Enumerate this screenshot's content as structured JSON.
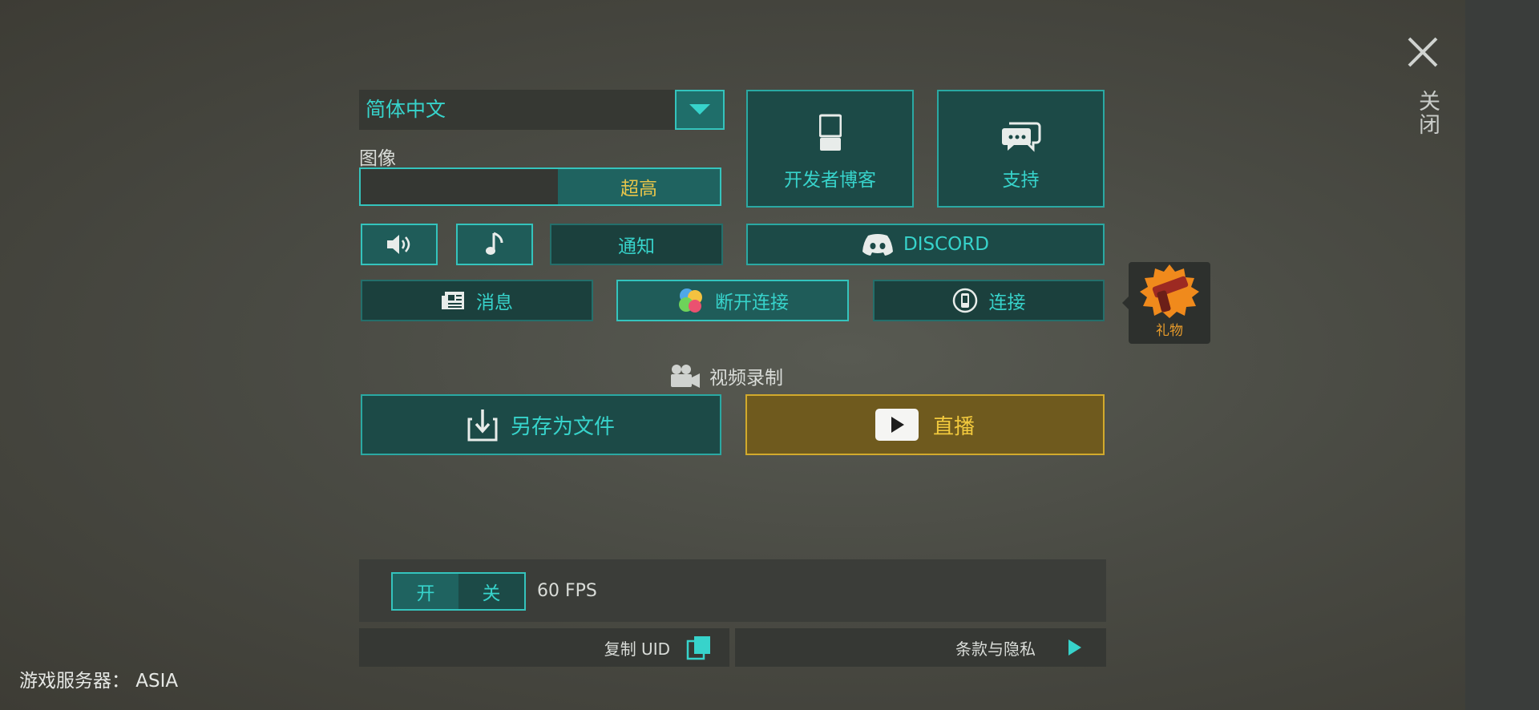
{
  "close": {
    "label": "关闭"
  },
  "language": {
    "selected": "简体中文"
  },
  "graphics": {
    "label": "图像",
    "quality_value": "超高",
    "quality_fraction": 0.46
  },
  "tiles": {
    "dev_blog": "开发者博客",
    "support": "支持"
  },
  "row_audio": {
    "notify": "通知",
    "discord": "DISCORD"
  },
  "row_links": {
    "news": "消息",
    "disconnect": "断开连接",
    "connect": "连接"
  },
  "gift": {
    "label": "礼物"
  },
  "recording": {
    "label": "视频录制",
    "save_file": "另存为文件",
    "live": "直播"
  },
  "fps": {
    "on": "开",
    "off": "关",
    "value": "60 FPS"
  },
  "footer": {
    "copy_uid": "复制 UID",
    "terms": "条款与隐私"
  },
  "server": {
    "label": "游戏服务器： ASIA"
  },
  "colors": {
    "teal": "#37d3cb",
    "gold": "#e7c54a",
    "panel": "#1c4a47",
    "live_bg": "#6f5a1e"
  }
}
